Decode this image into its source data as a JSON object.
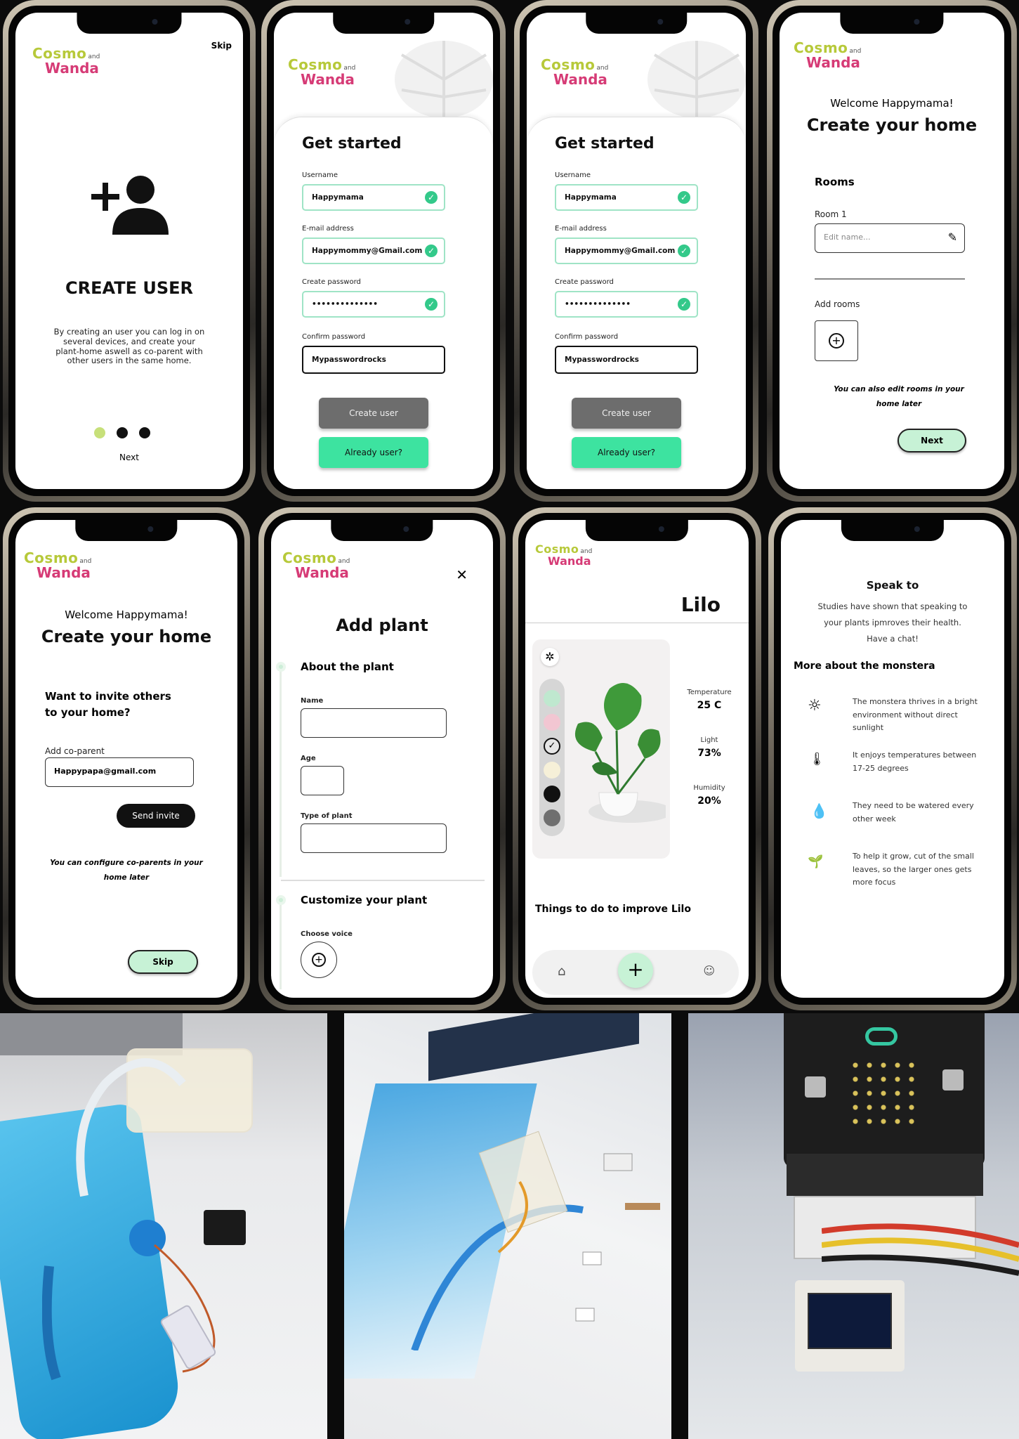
{
  "brand": {
    "name_line1": "Cosmo",
    "and": "and",
    "name_line2": "Wanda"
  },
  "screen1": {
    "skip": "Skip",
    "title": "CREATE USER",
    "description": "By creating an user you can log in on several devices, and create your plant-home aswell as co-parent with other users in the same home.",
    "next": "Next"
  },
  "signup": {
    "title": "Get started",
    "username_label": "Username",
    "username_value": "Happymama",
    "email_label": "E-mail address",
    "email_value": "Happymommy@Gmail.com",
    "password_label": "Create password",
    "password_value": "••••••••••••••",
    "confirm_label": "Confirm password",
    "confirm_value": "Mypasswordrocks",
    "create_button": "Create user",
    "already_button": "Already user?"
  },
  "home": {
    "welcome": "Welcome Happymama!",
    "title": "Create your home",
    "rooms_heading": "Rooms",
    "room1_label": "Room 1",
    "room1_placeholder": "Edit name...",
    "add_rooms": "Add rooms",
    "note": "You can also edit rooms in your home later",
    "next": "Next"
  },
  "invite": {
    "welcome": "Welcome Happymama!",
    "title": "Create your home",
    "question": "Want to invite others to your home?",
    "coparent_label": "Add co-parent",
    "coparent_value": "Happypapa@gmail.com",
    "send_invite": "Send invite",
    "note": "You can configure co-parents in your home later",
    "skip": "Skip"
  },
  "addplant": {
    "title": "Add plant",
    "section1": "About the plant",
    "name_label": "Name",
    "age_label": "Age",
    "type_label": "Type of plant",
    "section2": "Customize your plant",
    "voice_label": "Choose voice"
  },
  "plant": {
    "name": "Lilo",
    "temp_label": "Temperature",
    "temp_value": "25 C",
    "light_label": "Light",
    "light_value": "73%",
    "humidity_label": "Humidity",
    "humidity_value": "20%",
    "todo": "Things to do to improve Lilo",
    "swatches": [
      "#bfe8cf",
      "#f2c6d2",
      "#e6e6e6",
      "#f6f0d8",
      "#111111",
      "#6f6f6f"
    ]
  },
  "speak": {
    "title": "Speak to",
    "text": "Studies have shown that speaking to your plants ipmroves their health. Have a chat!",
    "more": "More about the monstera",
    "facts": [
      "The monstera thrives in a bright environment without direct sunlight",
      "It enjoys temperatures between 17-25 degrees",
      "They need to be watered every other week",
      "To help it grow, cut of the small leaves, so the larger ones gets more focus"
    ]
  },
  "colors": {
    "accent_green": "#3de3a0",
    "brand_lime": "#b7c93a",
    "brand_pink": "#d63b76"
  }
}
